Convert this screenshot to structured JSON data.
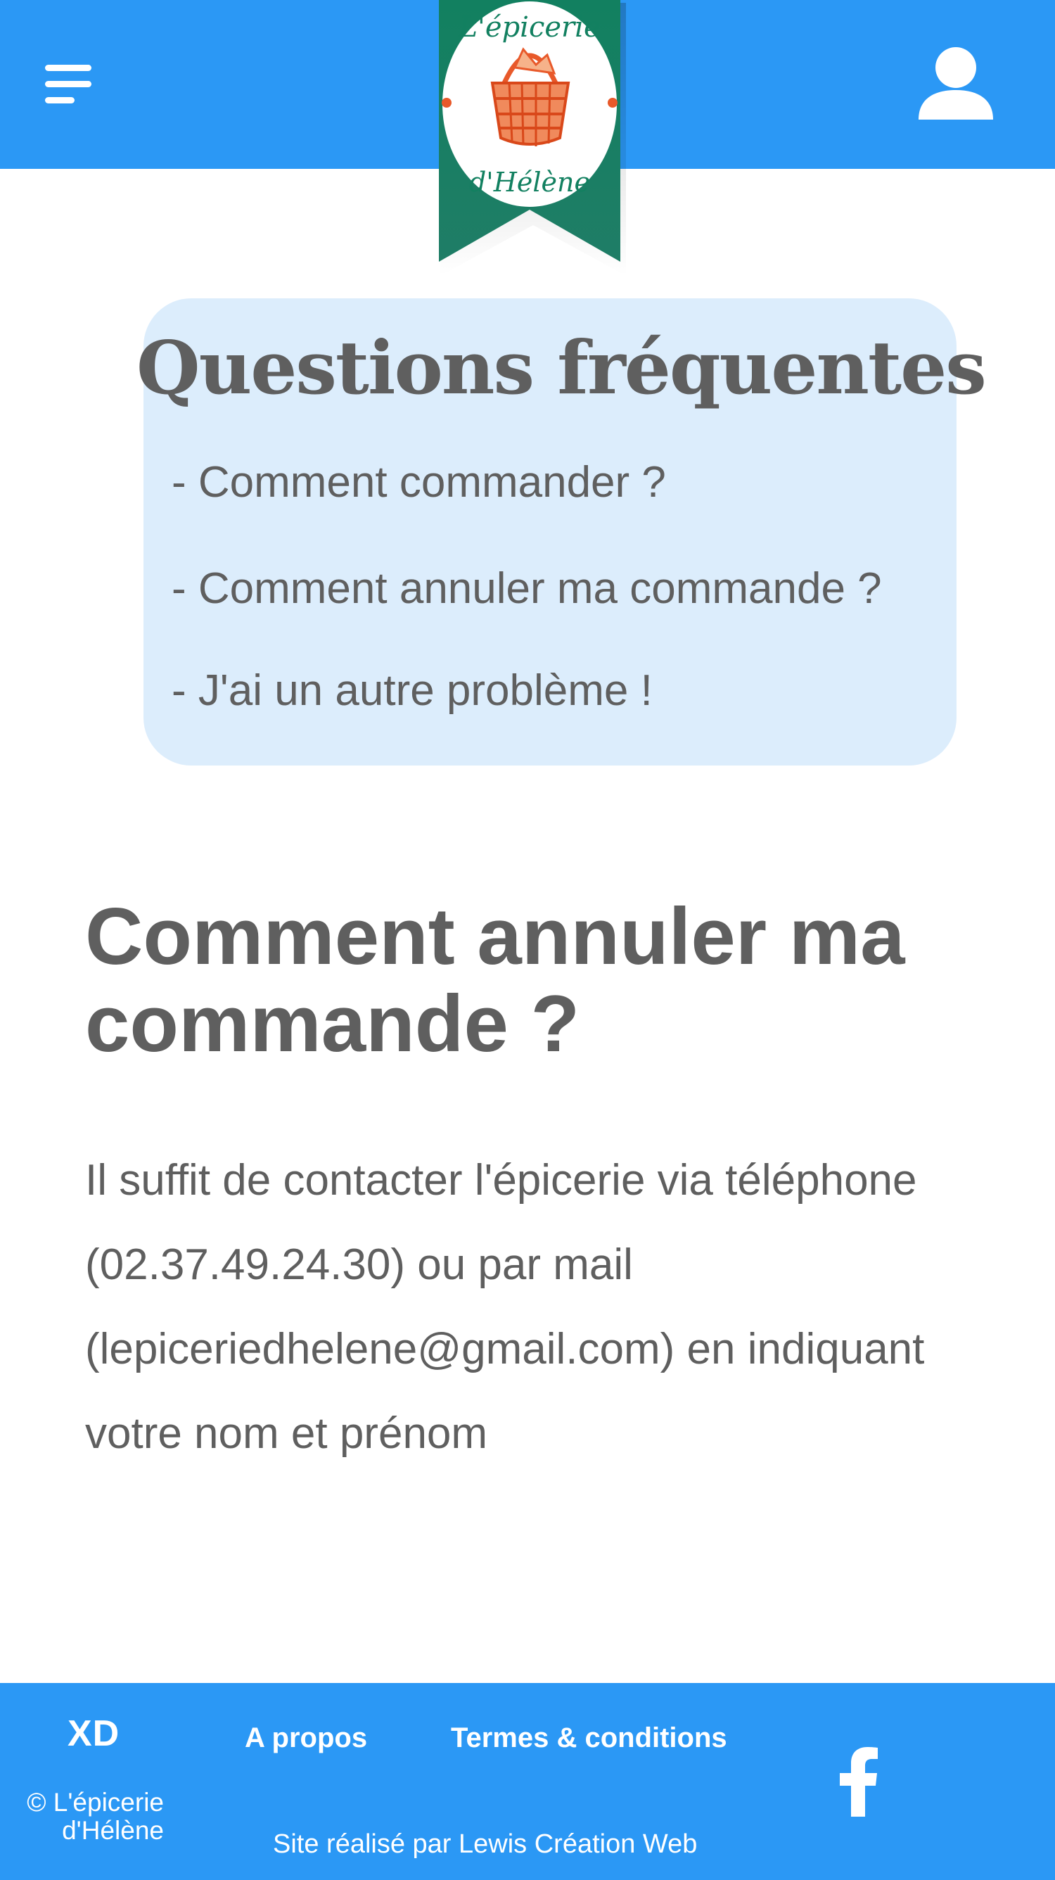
{
  "header": {
    "menu_icon": "hamburger-menu-icon",
    "user_icon": "user-account-icon",
    "logo": {
      "line1": "L'épicerie",
      "line2": "d'Hélène",
      "image": "basket-illustration"
    },
    "colors": {
      "bar": "#2b98f5",
      "ribbon": "#1d7a62",
      "basket": "#e8592a"
    }
  },
  "faq": {
    "title": "Questions fréquentes",
    "questions": [
      "- Comment commander ?",
      "- Comment annuler ma commande ?",
      "- J'ai un autre problème !"
    ],
    "card_color": "#dcedfc"
  },
  "answer": {
    "title": "Comment annuler ma commande ?",
    "text": "Il suffit de contacter l'épicerie via téléphone (02.37.49.24.30) ou par mail (lepiceriedhelene@gmail.com) en indiquant votre nom et prénom"
  },
  "footer": {
    "brand": "XD",
    "copyright": "© L'épicerie d'Hélène",
    "links": [
      "A propos",
      "Termes & conditions"
    ],
    "credit": "Site réalisé par Lewis Création Web",
    "social_icon": "facebook-icon"
  }
}
